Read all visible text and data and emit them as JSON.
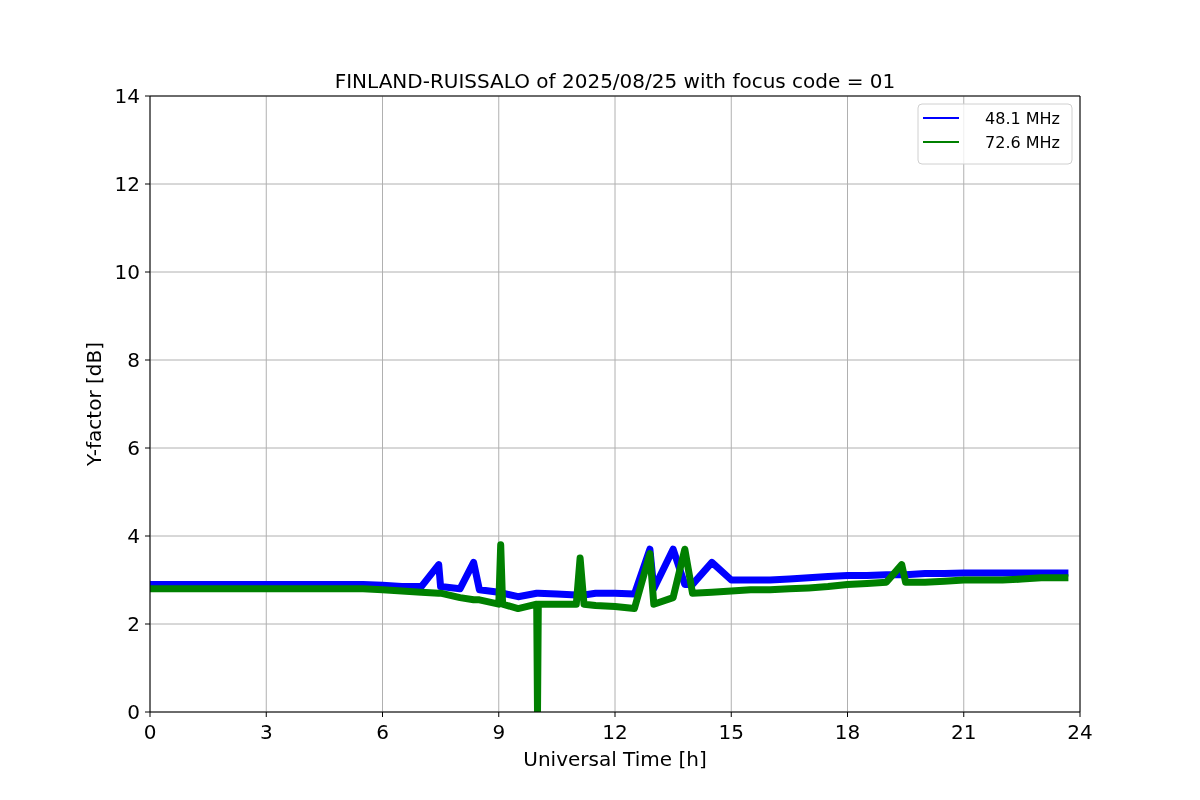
{
  "figure": {
    "chart_data": {
      "type": "line",
      "title": "FINLAND-RUISSALO of 2025/08/25 with focus code = 01",
      "xlabel": "Universal Time [h]",
      "ylabel": "Y-factor [dB]",
      "x": [
        0,
        0.5,
        1,
        1.5,
        2,
        2.5,
        3,
        3.5,
        4,
        4.5,
        5,
        5.5,
        6,
        6.5,
        7,
        7.45,
        7.5,
        8,
        8.35,
        8.5,
        9,
        9.05,
        9.1,
        9.5,
        9.98,
        10,
        10.02,
        10.5,
        11,
        11.1,
        11.2,
        11.5,
        12,
        12.5,
        12.9,
        13,
        13.5,
        13.8,
        14,
        14.5,
        15,
        15.5,
        16,
        16.5,
        17,
        17.5,
        18,
        18.5,
        19,
        19.4,
        19.5,
        20,
        20.5,
        21,
        21.5,
        22,
        22.5,
        23,
        23.5,
        23.7
      ],
      "series": [
        {
          "name": "48.1 MHz",
          "color": "#0000ff",
          "values": [
            2.9,
            2.9,
            2.9,
            2.9,
            2.9,
            2.9,
            2.9,
            2.9,
            2.9,
            2.9,
            2.9,
            2.9,
            2.88,
            2.85,
            2.85,
            3.35,
            2.85,
            2.8,
            3.4,
            2.78,
            2.72,
            2.72,
            2.7,
            2.62,
            2.7,
            2.7,
            2.7,
            2.68,
            2.66,
            2.66,
            2.66,
            2.7,
            2.7,
            2.68,
            3.7,
            2.8,
            3.7,
            2.9,
            2.9,
            3.4,
            3.0,
            3.0,
            3.0,
            3.02,
            3.05,
            3.08,
            3.1,
            3.1,
            3.12,
            3.12,
            3.12,
            3.15,
            3.15,
            3.16,
            3.16,
            3.16,
            3.16,
            3.16,
            3.16,
            3.16
          ]
        },
        {
          "name": "72.6 MHz",
          "color": "#008000",
          "values": [
            2.8,
            2.8,
            2.8,
            2.8,
            2.8,
            2.8,
            2.8,
            2.8,
            2.8,
            2.8,
            2.8,
            2.8,
            2.78,
            2.75,
            2.72,
            2.7,
            2.7,
            2.6,
            2.55,
            2.55,
            2.45,
            3.8,
            2.45,
            2.35,
            2.45,
            0,
            2.45,
            2.45,
            2.45,
            3.5,
            2.45,
            2.42,
            2.4,
            2.35,
            3.6,
            2.45,
            2.6,
            3.7,
            2.7,
            2.72,
            2.75,
            2.78,
            2.78,
            2.8,
            2.82,
            2.85,
            2.9,
            2.92,
            2.95,
            3.35,
            2.95,
            2.95,
            2.97,
            3.0,
            3.0,
            3.0,
            3.02,
            3.05,
            3.05,
            3.05
          ]
        }
      ],
      "xlim": [
        0,
        24
      ],
      "ylim": [
        0,
        14
      ],
      "xticks": [
        0,
        3,
        6,
        9,
        12,
        15,
        18,
        21,
        24
      ],
      "yticks": [
        0,
        2,
        4,
        6,
        8,
        10,
        12,
        14
      ],
      "grid": true,
      "legend": true
    }
  }
}
